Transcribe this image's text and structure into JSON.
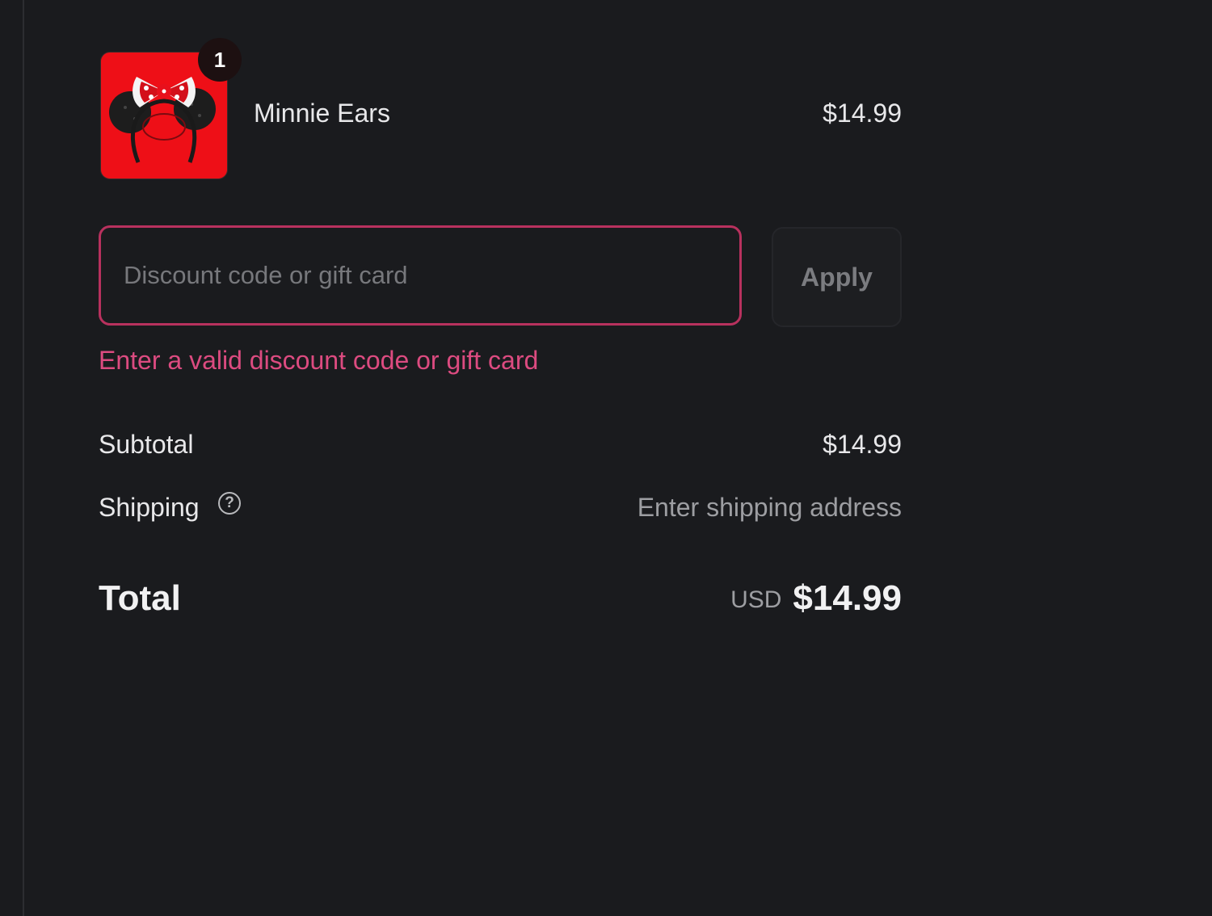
{
  "product": {
    "name": "Minnie Ears",
    "price": "$14.99",
    "quantity": "1",
    "image_icon": "minnie-ears-headband-image",
    "image_bg_color": "#ee0f17"
  },
  "discount": {
    "placeholder": "Discount code or gift card",
    "value": "",
    "apply_label": "Apply",
    "error": "Enter a valid discount code or gift card",
    "error_color": "#dc4b80"
  },
  "totals": {
    "subtotal_label": "Subtotal",
    "subtotal_value": "$14.99",
    "shipping_label": "Shipping",
    "shipping_value": "Enter shipping address",
    "shipping_help_icon": "question-circle-icon",
    "total_label": "Total",
    "currency": "USD",
    "total_value": "$14.99"
  }
}
